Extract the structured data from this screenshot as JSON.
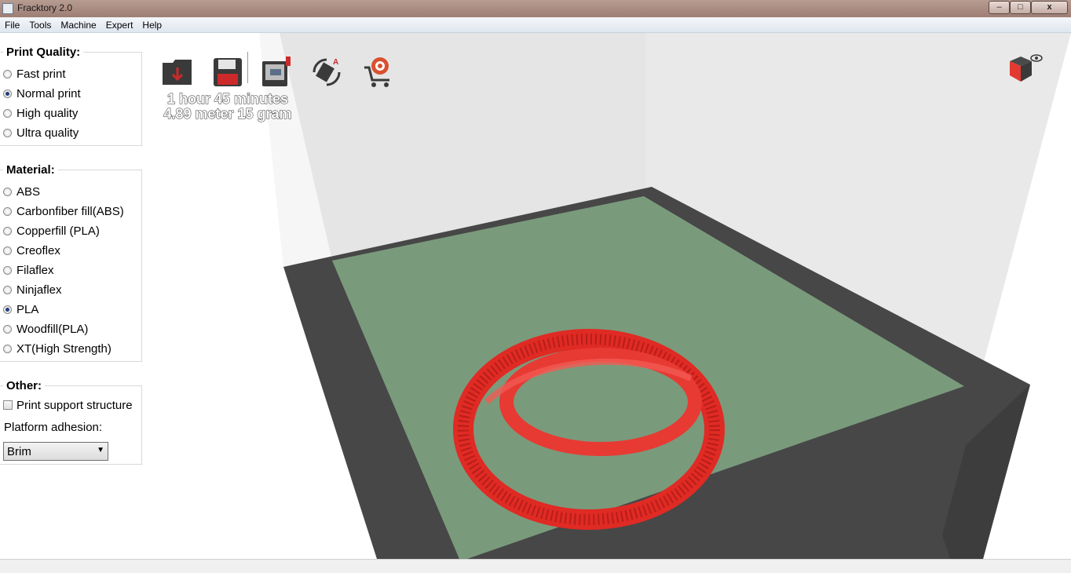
{
  "window": {
    "title": "Fracktory 2.0",
    "controls": {
      "minimize": "–",
      "maximize": "□",
      "close": "x"
    }
  },
  "menu": [
    "File",
    "Tools",
    "Machine",
    "Expert",
    "Help"
  ],
  "print_quality": {
    "title": "Print Quality:",
    "options": [
      "Fast print",
      "Normal print",
      "High quality",
      "Ultra quality"
    ],
    "selected": "Normal print"
  },
  "material": {
    "title": "Material:",
    "options": [
      "ABS",
      "Carbonfiber fill(ABS)",
      "Copperfill (PLA)",
      "Creoflex",
      "Filaflex",
      "Ninjaflex",
      "PLA",
      "Woodfill(PLA)",
      "XT(High Strength)"
    ],
    "selected": "PLA"
  },
  "other": {
    "title": "Other:",
    "support_label": "Print support structure",
    "support_checked": false,
    "adhesion_label": "Platform adhesion:",
    "adhesion_value": "Brim"
  },
  "toolbar": {
    "icons": [
      "load-file-icon",
      "save-icon",
      "print-usb-icon",
      "rotate-reset-icon",
      "filament-shop-icon"
    ],
    "accent_color": "#cc2a2a"
  },
  "print_info": {
    "time": "1 hour 45 minutes",
    "material": "4.89 meter 15 gram"
  },
  "colors": {
    "bed": "#7a9a7c",
    "frame": "#474747",
    "model": "#e02a24"
  }
}
